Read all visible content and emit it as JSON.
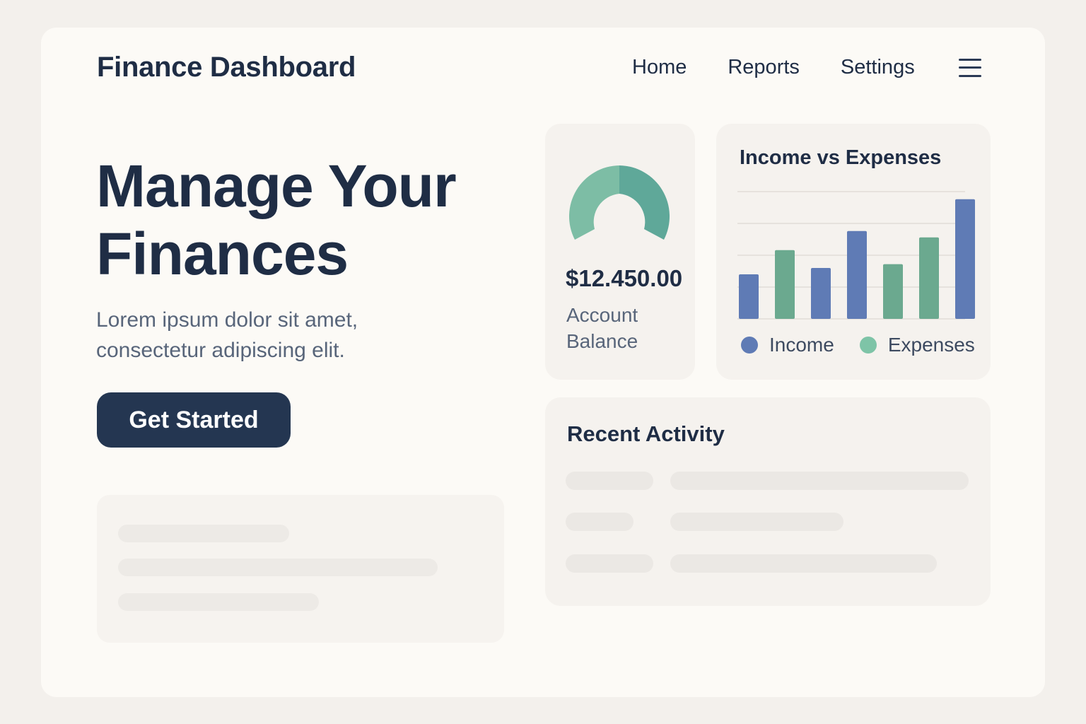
{
  "header": {
    "brand": "Finance Dashboard",
    "nav": [
      "Home",
      "Reports",
      "Settings"
    ],
    "menu_icon": "hamburger-menu-icon"
  },
  "hero": {
    "title_line1": "Manage Your",
    "title_line2": "Finances",
    "subtitle": "Lorem ipsum  dolor sit amet, consectetur adipiscing elit.",
    "cta_label": "Get Started"
  },
  "balance": {
    "amount": "$12.450.00",
    "label": "Account Balance",
    "gauge_colors": [
      "#7dbda5",
      "#5fa899"
    ]
  },
  "chart_card": {
    "title": "Income vs Expenses"
  },
  "chart_data": {
    "type": "bar",
    "title": "Income vs Expenses",
    "categories": [
      "1",
      "2",
      "3",
      "4",
      "5",
      "6",
      "7"
    ],
    "series_colors": {
      "Income": "#5f7bb5",
      "Expenses": "#6ba98f"
    },
    "bars": [
      {
        "series": "Income",
        "value": 35
      },
      {
        "series": "Expenses",
        "value": 54
      },
      {
        "series": "Income",
        "value": 40
      },
      {
        "series": "Income",
        "value": 69
      },
      {
        "series": "Expenses",
        "value": 43
      },
      {
        "series": "Expenses",
        "value": 64
      },
      {
        "series": "Income",
        "value": 94
      }
    ],
    "ylim": [
      0,
      100
    ],
    "grid": true,
    "legend": [
      {
        "name": "Income",
        "color": "#5f7bb5"
      },
      {
        "name": "Expenses",
        "color": "#7ec4a7"
      }
    ],
    "legend_position": "bottom"
  },
  "activity": {
    "title": "Recent Activity"
  }
}
